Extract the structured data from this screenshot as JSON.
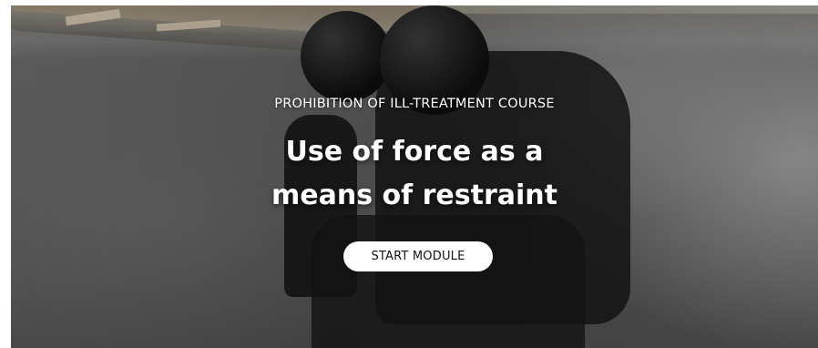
{
  "hero": {
    "eyebrow": "PROHIBITION OF ILL-TREATMENT COURSE",
    "title_line_1": "Use of force as a",
    "title_line_2": "means of restraint",
    "cta_label": "START MODULE"
  },
  "colors": {
    "text": "#ffffff",
    "button_bg": "#ffffff",
    "button_text": "#111111"
  }
}
